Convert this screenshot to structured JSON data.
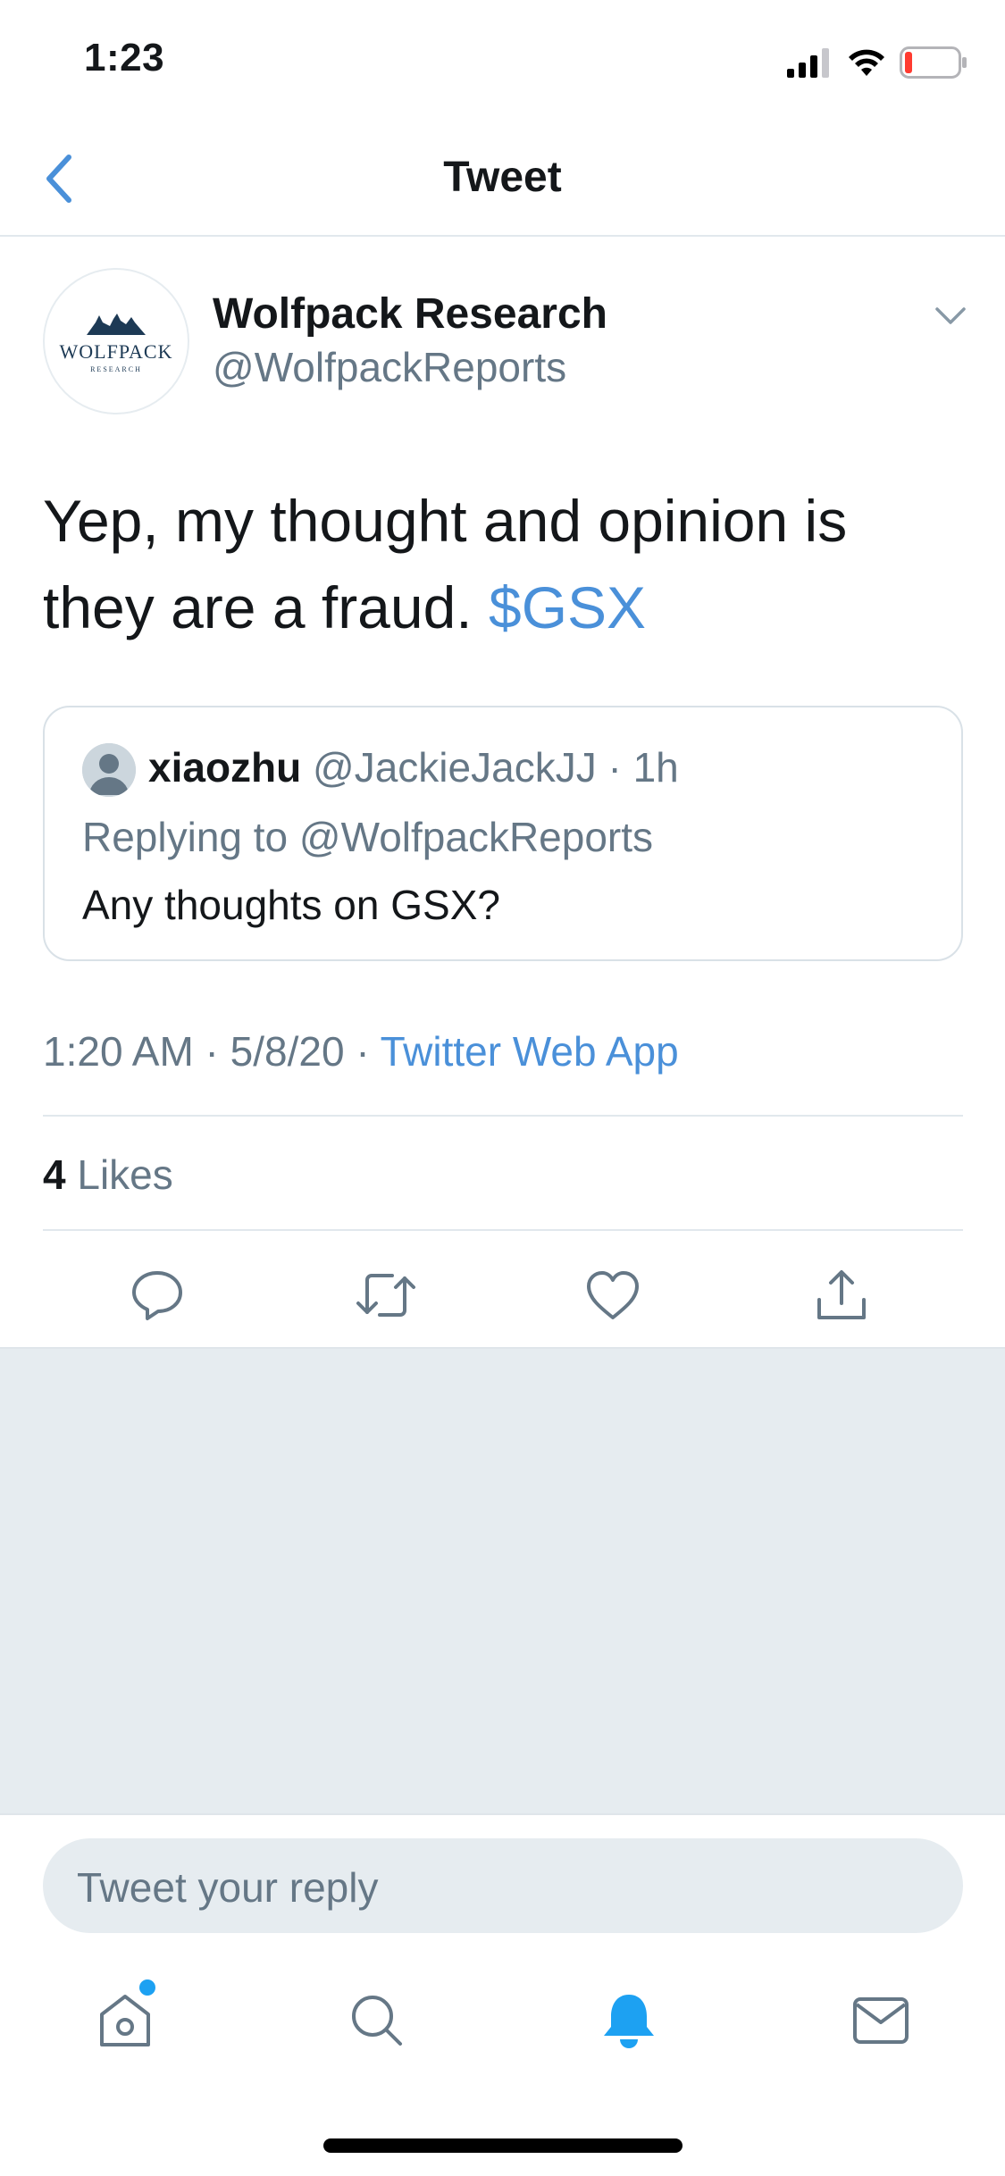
{
  "status_bar": {
    "time": "1:23",
    "icons": [
      "cellular-signal-icon",
      "wifi-icon",
      "battery-low-icon"
    ]
  },
  "nav": {
    "back_icon": "chevron-left-icon",
    "title": "Tweet"
  },
  "tweet": {
    "avatar_logo": "WOLFPACK",
    "avatar_logo_sub": "RESEARCH",
    "author_name": "Wolfpack Research",
    "author_handle": "@WolfpackReports",
    "text": "Yep, my thought and opinion is they are a fraud.",
    "cashtag": "$GSX",
    "timestamp": "1:20 AM · 5/8/20 · ",
    "source": "Twitter Web App",
    "likes_count": "4",
    "likes_label": "Likes"
  },
  "quoted_tweet": {
    "author_name": "xiaozhu",
    "author_handle": "@JackieJackJJ",
    "separator": " · ",
    "time_ago": "1h",
    "replying_to": "Replying to @WolfpackReports",
    "text": "Any thoughts on GSX?"
  },
  "actions": [
    "reply-icon",
    "retweet-icon",
    "like-icon",
    "share-icon"
  ],
  "reply_box": {
    "placeholder": "Tweet your reply"
  },
  "tab_bar": [
    "home-icon",
    "search-icon",
    "notifications-icon",
    "messages-icon"
  ],
  "colors": {
    "accent": "#1da1f2",
    "link": "#4a90d9",
    "secondary_text": "#657786",
    "primary_text": "#14171a",
    "divider": "#e1e8ed",
    "gray_fill": "#e6ecf0"
  }
}
